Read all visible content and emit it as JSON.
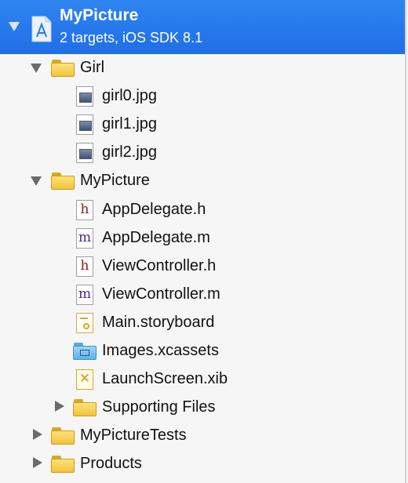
{
  "project": {
    "name": "MyPicture",
    "subtitle": "2 targets, iOS SDK 8.1",
    "icon": "xcode-project-icon"
  },
  "tree": [
    {
      "key": "girl-folder",
      "label": "Girl",
      "kind": "folder",
      "expanded": true
    },
    {
      "key": "girl0",
      "label": "girl0.jpg",
      "kind": "image-file"
    },
    {
      "key": "girl1",
      "label": "girl1.jpg",
      "kind": "image-file"
    },
    {
      "key": "girl2",
      "label": "girl2.jpg",
      "kind": "image-file"
    },
    {
      "key": "mypicture-folder",
      "label": "MyPicture",
      "kind": "folder",
      "expanded": true
    },
    {
      "key": "appdelegate-h",
      "label": "AppDelegate.h",
      "kind": "header-file",
      "letter": "h"
    },
    {
      "key": "appdelegate-m",
      "label": "AppDelegate.m",
      "kind": "implementation-file",
      "letter": "m"
    },
    {
      "key": "viewcontroller-h",
      "label": "ViewController.h",
      "kind": "header-file",
      "letter": "h"
    },
    {
      "key": "viewcontroller-m",
      "label": "ViewController.m",
      "kind": "implementation-file",
      "letter": "m"
    },
    {
      "key": "main-storyboard",
      "label": "Main.storyboard",
      "kind": "storyboard-file"
    },
    {
      "key": "images-xcassets",
      "label": "Images.xcassets",
      "kind": "asset-catalog"
    },
    {
      "key": "launchscreen-xib",
      "label": "LaunchScreen.xib",
      "kind": "xib-file"
    },
    {
      "key": "supporting-files",
      "label": "Supporting Files",
      "kind": "folder",
      "expanded": false
    },
    {
      "key": "mypicturetests",
      "label": "MyPictureTests",
      "kind": "folder",
      "expanded": false
    },
    {
      "key": "products",
      "label": "Products",
      "kind": "folder",
      "expanded": false
    }
  ],
  "colors": {
    "selection": "#2a7ef0",
    "header_letter": "#8b1a1a",
    "impl_letter": "#4b2a8a",
    "folder": "#f2c33c"
  }
}
